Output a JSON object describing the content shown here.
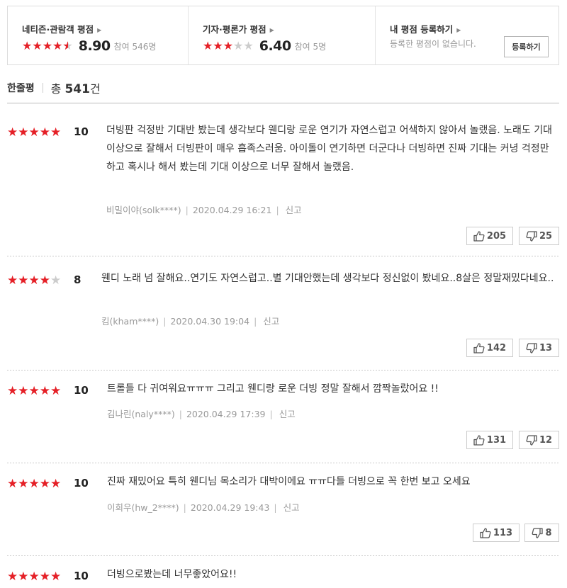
{
  "score_summary": {
    "netizen": {
      "title": "네티즌·관람객 평점",
      "score": "8.90",
      "participants": "참여 546명",
      "star_fill": 4.5
    },
    "critic": {
      "title": "기자·평론가 평점",
      "score": "6.40",
      "participants": "참여 5명",
      "star_fill": 3.0
    },
    "mine": {
      "title": "내 평점 등록하기",
      "description": "등록한 평점이 없습니다.",
      "button": "등록하기"
    }
  },
  "summary": {
    "label": "한줄평",
    "total_prefix": "총 ",
    "count": "541",
    "total_suffix": "건"
  },
  "colors": {
    "star_on": "#e52027",
    "star_off": "#cccccc"
  },
  "icons": {
    "thumbs_up": "thumbs-up-icon",
    "thumbs_down": "thumbs-down-icon",
    "arrow": "arrow-right-icon"
  },
  "reviews": [
    {
      "stars": 5,
      "score": "10",
      "text": "더빙판 걱정반 기대반 봤는데 생각보다 웬디랑 로운 연기가 자연스럽고 어색하지 않아서 놀랬음. 노래도 기대 이상으로 잘해서 더빙판이 매우 흡족스러움. 아이돌이 연기하면 더군다나 더빙하면 진짜 기대는 커녕 걱정만 하고 혹시나 해서 봤는데 기대 이상으로 너무 잘해서 놀랬음.",
      "author": "비밀이야(solk****)",
      "date": "2020.04.29 16:21",
      "report": "신고",
      "likes": "205",
      "dislikes": "25"
    },
    {
      "stars": 4,
      "score": "8",
      "text": "웬디 노래 넘 잘해요..연기도 자연스럽고..별 기대안했는데 생각보다 정신없이 봤네요..8살은 정말재밌다네요..",
      "author": "킴(kham****)",
      "date": "2020.04.30 19:04",
      "report": "신고",
      "likes": "142",
      "dislikes": "13"
    },
    {
      "stars": 5,
      "score": "10",
      "text": "트롤들 다 귀여워요ㅠㅠㅠ 그리고 웬디랑 로운 더빙 정말 잘해서 깜짝놀랐어요 !!",
      "author": "김나린(naly****)",
      "date": "2020.04.29 17:39",
      "report": "신고",
      "likes": "131",
      "dislikes": "12"
    },
    {
      "stars": 5,
      "score": "10",
      "text": "진짜 재밌어요 특히 웬디님 목소리가 대박이에요 ㅠㅠ다들 더빙으로 꼭 한번 보고 오세요",
      "author": "이희우(hw_2****)",
      "date": "2020.04.29 19:43",
      "report": "신고",
      "likes": "113",
      "dislikes": "8"
    },
    {
      "stars": 5,
      "score": "10",
      "text": "더빙으로봤는데 너무좋았어요!!"
    }
  ]
}
